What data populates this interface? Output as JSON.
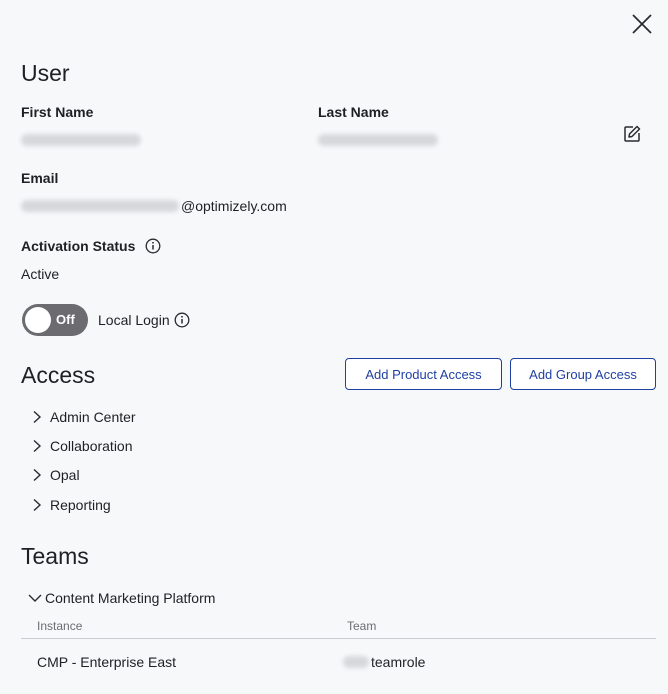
{
  "user_section": {
    "title": "User",
    "first_name_label": "First Name",
    "last_name_label": "Last Name",
    "email_label": "Email",
    "email_domain": "@optimizely.com",
    "activation_status_label": "Activation Status",
    "activation_status_value": "Active",
    "local_login_label": "Local Login",
    "toggle_state": "Off"
  },
  "access_section": {
    "title": "Access",
    "add_product_access": "Add Product Access",
    "add_group_access": "Add Group Access",
    "items": [
      {
        "label": "Admin Center"
      },
      {
        "label": "Collaboration"
      },
      {
        "label": "Opal"
      },
      {
        "label": "Reporting"
      }
    ]
  },
  "teams_section": {
    "title": "Teams",
    "group": "Content Marketing Platform",
    "columns": {
      "instance": "Instance",
      "team": "Team"
    },
    "rows": [
      {
        "instance": "CMP - Enterprise East",
        "team": "teamrole"
      }
    ]
  },
  "icons": {
    "close": "close-icon",
    "edit": "edit-icon",
    "info": "info-icon",
    "chevron_right": "chevron-right-icon",
    "chevron_down": "chevron-down-icon"
  },
  "colors": {
    "accent": "#1f3fa3",
    "toggle_off": "#6b6b70",
    "background": "#f7f8fa"
  }
}
